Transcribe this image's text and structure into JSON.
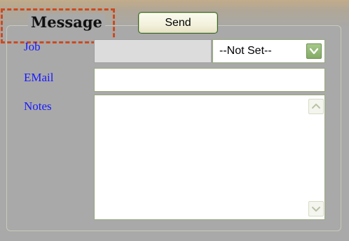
{
  "form": {
    "legend": "Message",
    "send_label": "Send"
  },
  "fields": {
    "job_label": "Job",
    "job_value": "",
    "job_select_value": "--Not Set--",
    "email_label": "EMail",
    "email_value": "",
    "notes_label": "Notes",
    "notes_value": ""
  },
  "icons": {
    "select_arrow": "chevron-down-icon",
    "scroll_up": "scroll-up-icon",
    "scroll_down": "scroll-down-icon"
  },
  "colors": {
    "label": "#1a1aff",
    "highlight": "#cc4a1f",
    "arrow_button": "#83aa66"
  }
}
